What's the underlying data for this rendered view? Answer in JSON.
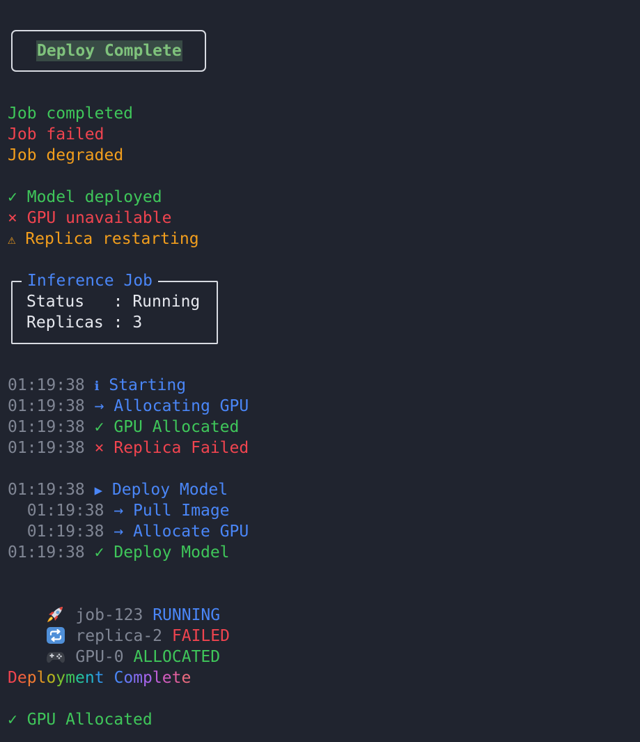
{
  "header": {
    "title": "Deploy Complete"
  },
  "status_lines": [
    {
      "text": "Job completed",
      "color": "#3fc65a"
    },
    {
      "text": "Job failed",
      "color": "#f0444f"
    },
    {
      "text": "Job degraded",
      "color": "#f29e1d"
    }
  ],
  "icon_lines": [
    {
      "icon": "✓",
      "icon_name": "check-icon",
      "text": "Model deployed",
      "color": "#3fc65a"
    },
    {
      "icon": "×",
      "icon_name": "cross-icon",
      "text": "GPU unavailable",
      "color": "#f0444f"
    },
    {
      "icon": "⚠",
      "icon_name": "warning-icon",
      "text": "Replica restarting",
      "color": "#f29e1d"
    }
  ],
  "job_box": {
    "title": "Inference Job",
    "rows": [
      {
        "label": "Status  ",
        "sep": " : ",
        "value": "Running"
      },
      {
        "label": "Replicas",
        "sep": " : ",
        "value": "3"
      }
    ]
  },
  "log_lines": [
    {
      "time": "01:19:38",
      "icon": "ℹ",
      "icon_name": "info-icon",
      "text": "Starting",
      "color": "#4a86f7"
    },
    {
      "time": "01:19:38",
      "icon": "→",
      "icon_name": "arrow-right-icon",
      "text": "Allocating GPU",
      "color": "#4a86f7"
    },
    {
      "time": "01:19:38",
      "icon": "✓",
      "icon_name": "check-icon",
      "text": "GPU Allocated",
      "color": "#3fc65a"
    },
    {
      "time": "01:19:38",
      "icon": "×",
      "icon_name": "cross-icon",
      "text": "Replica Failed",
      "color": "#f0444f"
    }
  ],
  "step_lines": [
    {
      "time": "01:19:38",
      "icon": "▶",
      "icon_name": "play-icon",
      "text": "Deploy Model",
      "color": "#4a86f7",
      "indent": false
    },
    {
      "time": "01:19:38",
      "icon": "→",
      "icon_name": "arrow-right-icon",
      "text": "Pull Image",
      "color": "#4a86f7",
      "indent": true
    },
    {
      "time": "01:19:38",
      "icon": "→",
      "icon_name": "arrow-right-icon",
      "text": "Allocate GPU",
      "color": "#4a86f7",
      "indent": true
    },
    {
      "time": "01:19:38",
      "icon": "✓",
      "icon_name": "check-icon",
      "text": "Deploy Model",
      "color": "#3fc65a",
      "indent": false
    }
  ],
  "resource_lines": [
    {
      "icon_name": "rocket-icon",
      "name": "job-123",
      "status": "RUNNING",
      "color": "#4a86f7"
    },
    {
      "icon_name": "repeat-icon",
      "name": "replica-2",
      "status": "FAILED",
      "color": "#f0444f"
    },
    {
      "icon_name": "gamepad-icon",
      "name": "GPU-0",
      "status": "ALLOCATED",
      "color": "#3fc65a"
    }
  ],
  "banner": {
    "text": "Deployment Complete",
    "colors": [
      "#f0444f",
      "#f2603e",
      "#f27a31",
      "#e39523",
      "#b9b31e",
      "#7cc22e",
      "#3fc65a",
      "#27c49b",
      "#23b6c9",
      "#2f97e8",
      "#4a86f7",
      "#6a77f6",
      "#8a6cf2",
      "#a764ea",
      "#bf5fd8",
      "#d35cbd",
      "#e25f9e",
      "#eb6a7f",
      "#ef7a63"
    ]
  },
  "final_line": {
    "icon": "✓",
    "icon_name": "check-icon",
    "text": "GPU Allocated",
    "color": "#3fc65a"
  }
}
